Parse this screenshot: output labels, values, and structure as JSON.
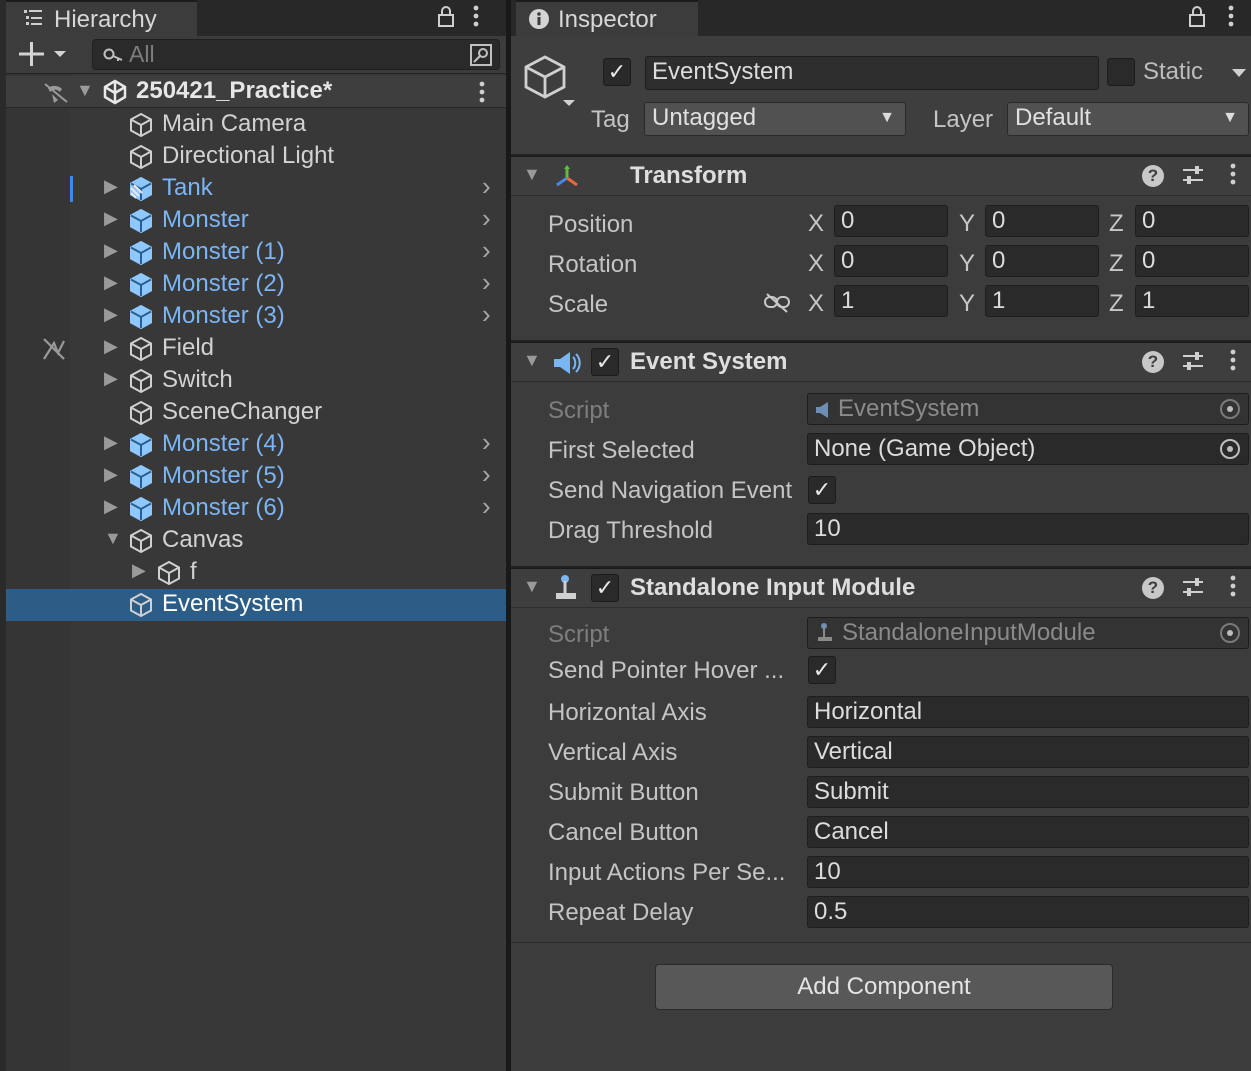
{
  "hierarchy": {
    "tab_title": "Hierarchy",
    "search_placeholder": "All",
    "scene_name": "250421_Practice*",
    "items": [
      {
        "label": "Main Camera"
      },
      {
        "label": "Directional Light"
      },
      {
        "label": "Tank"
      },
      {
        "label": "Monster"
      },
      {
        "label": "Monster (1)"
      },
      {
        "label": "Monster (2)"
      },
      {
        "label": "Monster (3)"
      },
      {
        "label": "Field"
      },
      {
        "label": "Switch"
      },
      {
        "label": "SceneChanger"
      },
      {
        "label": "Monster (4)"
      },
      {
        "label": "Monster (5)"
      },
      {
        "label": "Monster (6)"
      },
      {
        "label": "Canvas"
      },
      {
        "label": "f"
      },
      {
        "label": "EventSystem"
      }
    ]
  },
  "inspector": {
    "tab_title": "Inspector",
    "object_name": "EventSystem",
    "static_label": "Static",
    "tag_label": "Tag",
    "tag_value": "Untagged",
    "layer_label": "Layer",
    "layer_value": "Default",
    "transform": {
      "title": "Transform",
      "position_label": "Position",
      "rotation_label": "Rotation",
      "scale_label": "Scale",
      "x": "X",
      "y": "Y",
      "z": "Z",
      "position": [
        "0",
        "0",
        "0"
      ],
      "rotation": [
        "0",
        "0",
        "0"
      ],
      "scale": [
        "1",
        "1",
        "1"
      ]
    },
    "event_system": {
      "title": "Event System",
      "script_label": "Script",
      "script_value": "EventSystem",
      "first_selected_label": "First Selected",
      "first_selected_value": "None (Game Object)",
      "send_nav_label": "Send Navigation Event",
      "drag_threshold_label": "Drag Threshold",
      "drag_threshold_value": "10"
    },
    "input_module": {
      "title": "Standalone Input Module",
      "script_label": "Script",
      "script_value": "StandaloneInputModule",
      "send_pointer_label": "Send Pointer Hover ...",
      "horizontal_axis_label": "Horizontal Axis",
      "horizontal_axis_value": "Horizontal",
      "vertical_axis_label": "Vertical Axis",
      "vertical_axis_value": "Vertical",
      "submit_label": "Submit Button",
      "submit_value": "Submit",
      "cancel_label": "Cancel Button",
      "cancel_value": "Cancel",
      "input_actions_label": "Input Actions Per Se...",
      "input_actions_value": "10",
      "repeat_delay_label": "Repeat Delay",
      "repeat_delay_value": "0.5"
    },
    "add_component": "Add Component"
  },
  "colors": {
    "prefab_text": "#7cb4f5",
    "selection": "#2c5d87",
    "panel": "#383838"
  }
}
